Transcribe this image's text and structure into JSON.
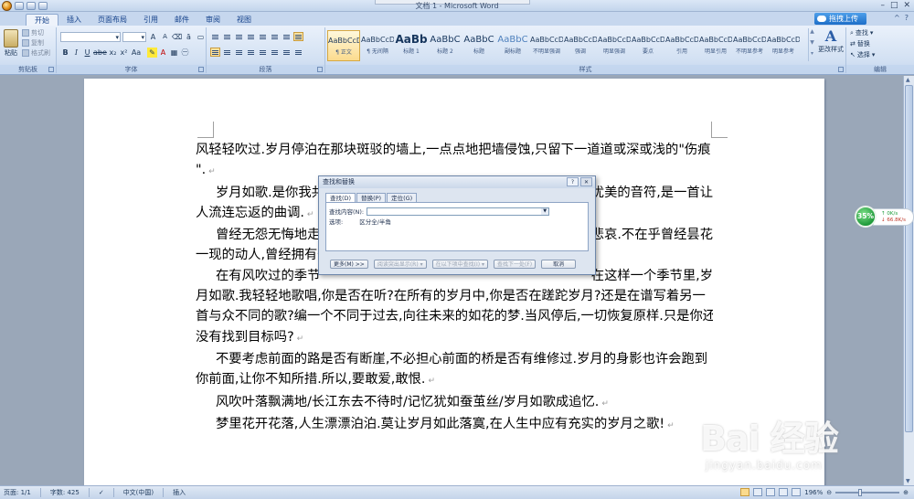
{
  "window": {
    "title": "文档 1 - Microsoft Word",
    "controls": [
      "–",
      "□",
      "✕"
    ]
  },
  "tabs": [
    "开始",
    "插入",
    "页面布局",
    "引用",
    "邮件",
    "审阅",
    "视图"
  ],
  "active_tab": "开始",
  "share_button": "拖拽上传",
  "ribbon": {
    "clipboard": {
      "label": "剪贴板",
      "paste": "粘贴",
      "cut": "剪切",
      "copy": "复制",
      "format_painter": "格式刷"
    },
    "font": {
      "label": "字体",
      "size_buttons": [
        "A",
        "A",
        "Aa",
        "A"
      ]
    },
    "paragraph": {
      "label": "段落"
    },
    "styles": {
      "label": "样式",
      "items": [
        {
          "sample": "AaBbCcDd",
          "name": "¶ 正文",
          "cls": ""
        },
        {
          "sample": "AaBbCcDd",
          "name": "¶ 无间隔",
          "cls": ""
        },
        {
          "sample": "AaBb",
          "name": "标题 1",
          "cls": "big"
        },
        {
          "sample": "AaBbC",
          "name": "标题 2",
          "cls": "med"
        },
        {
          "sample": "AaBbC",
          "name": "标题",
          "cls": "med"
        },
        {
          "sample": "AaBbC",
          "name": "副标题",
          "cls": "med2"
        },
        {
          "sample": "AaBbCcDd",
          "name": "不明显强调",
          "cls": ""
        },
        {
          "sample": "AaBbCcDd",
          "name": "强调",
          "cls": ""
        },
        {
          "sample": "AaBbCcDd",
          "name": "明显强调",
          "cls": ""
        },
        {
          "sample": "AaBbCcDd",
          "name": "要点",
          "cls": ""
        },
        {
          "sample": "AaBbCcDd",
          "name": "引用",
          "cls": ""
        },
        {
          "sample": "AaBbCcDd",
          "name": "明显引用",
          "cls": ""
        },
        {
          "sample": "AaBbCcDd",
          "name": "不明显参考",
          "cls": ""
        },
        {
          "sample": "AaBbCcDd",
          "name": "明显参考",
          "cls": ""
        }
      ],
      "change_styles": "更改样式"
    },
    "editing": {
      "label": "编辑",
      "find": "查找",
      "replace": "替换",
      "select": "选择"
    }
  },
  "document": {
    "lines": [
      {
        "text": "风轻轻吹过.岁月停泊在那块斑驳的墙上,一点点地把墙侵蚀,只留下一道道或深或浅的\"伤痕",
        "indent": false,
        "mark": false
      },
      {
        "text": "\".",
        "indent": false,
        "mark": true
      },
      {
        "text": "岁月如歌.是你我共",
        "indent": true,
        "mark": false,
        "tail": "优美的音符,是一首让"
      },
      {
        "text": "人流连忘返的曲调.",
        "indent": false,
        "mark": true
      },
      {
        "text": "曾经无怨无悔地走",
        "indent": true,
        "mark": false,
        "tail": "悲哀.不在乎曾经昙花"
      },
      {
        "text": "一现的动人,曾经拥有一",
        "indent": false,
        "mark": false
      },
      {
        "text": "在有风吹过的季节",
        "indent": true,
        "mark": false,
        "tail": "在这样一个季节里,岁"
      },
      {
        "text": "月如歌.我轻轻地歌唱,你是否在听?在所有的岁月中,你是否在蹉跎岁月?还是在谱写着另一",
        "indent": false,
        "mark": false
      },
      {
        "text": "首与众不同的歌?编一个不同于过去,向往未来的如花的梦.当风停后,一切恢复原样.只是你还",
        "indent": false,
        "mark": false
      },
      {
        "text": "没有找到目标吗?",
        "indent": false,
        "mark": true
      },
      {
        "text": "不要考虑前面的路是否有断崖,不必担心前面的桥是否有维修过.岁月的身影也许会跑到",
        "indent": true,
        "mark": false
      },
      {
        "text": "你前面,让你不知所措.所以,要敢爱,敢恨.",
        "indent": false,
        "mark": true
      },
      {
        "text": "风吹叶落飘满地/长江东去不待时/记忆犹如蚕茧丝/岁月如歌成追忆.",
        "indent": true,
        "mark": true
      },
      {
        "text": "梦里花开花落,人生漂漂泊泊.莫让岁月如此落寞,在人生中应有充实的岁月之歌!",
        "indent": true,
        "mark": true
      }
    ]
  },
  "find_dialog": {
    "title": "查找和替换",
    "title_buttons": [
      "?",
      "✕"
    ],
    "tabs": [
      "查找(D)",
      "替换(P)",
      "定位(G)"
    ],
    "active_tab": "查找(D)",
    "find_label": "查找内容(N):",
    "find_value": "",
    "options_label": "选项:",
    "options_value": "区分全/半角",
    "buttons": {
      "more": "更多(M) >>",
      "reading_highlight": "阅读突出显示(R) ▾",
      "find_in": "在以下项中查找(I) ▾",
      "find_next": "查找下一处(F)",
      "cancel": "取消"
    }
  },
  "speed_widget": {
    "percent": "35%",
    "up": "0K/s",
    "down": "66.8K/s"
  },
  "status": {
    "page": "页面: 1/1",
    "words": "字数: 425",
    "language": "中文(中国)",
    "mode": "插入",
    "zoom": "196%"
  },
  "watermark": {
    "main": "Bai 经验",
    "sub": "jingyan.baidu.com"
  },
  "colors": {
    "ribbon": "#d3e1f3",
    "accent": "#15428b",
    "widget_green": "#1f9a3a"
  }
}
